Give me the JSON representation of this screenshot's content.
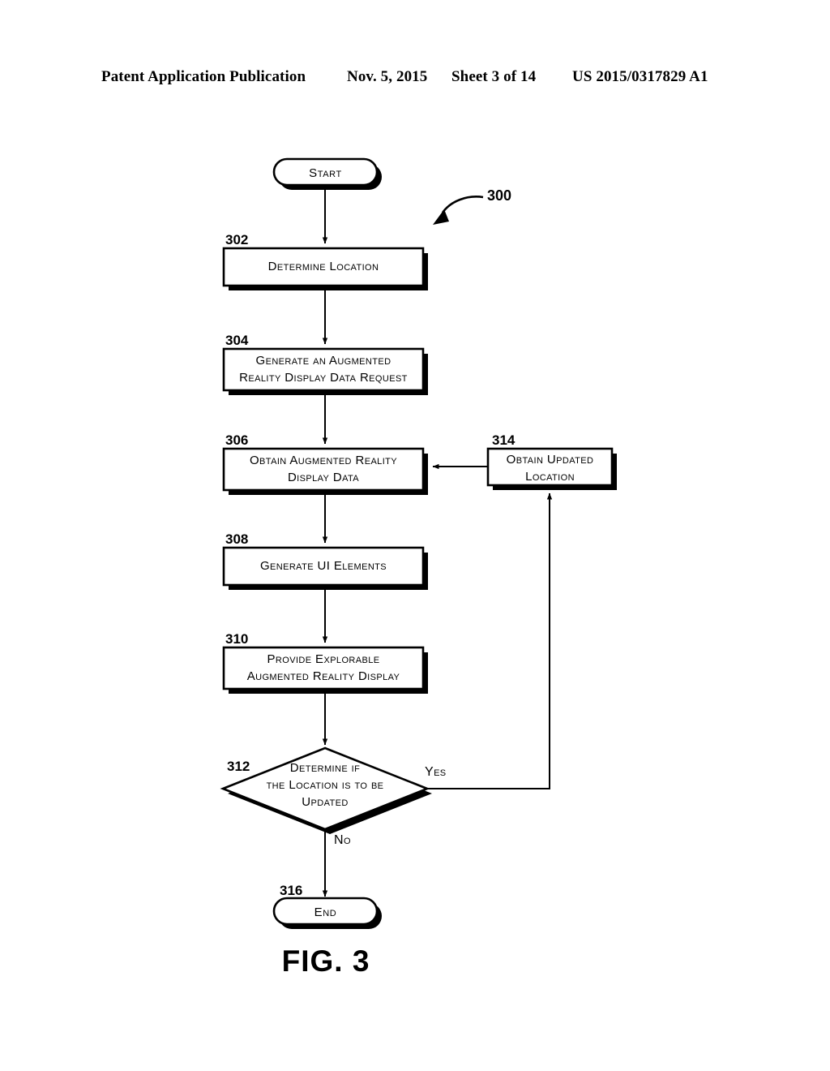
{
  "header": {
    "publication": "Patent Application Publication",
    "date": "Nov. 5, 2015",
    "sheet": "Sheet 3 of 14",
    "document_number": "US 2015/0317829 A1"
  },
  "figure": {
    "caption": "FIG. 3",
    "diagram_reference": "300"
  },
  "flowchart": {
    "start": {
      "ref": "",
      "label": "Start"
    },
    "end": {
      "ref": "316",
      "label": "End"
    },
    "nodes": [
      {
        "ref": "302",
        "label": "Determine Location",
        "lines": [
          "Determine Location"
        ],
        "shape": "process"
      },
      {
        "ref": "304",
        "label": "Generate an Augmented Reality Display Data Request",
        "lines": [
          "Generate an Augmented",
          "Reality Display Data Request"
        ],
        "shape": "process"
      },
      {
        "ref": "306",
        "label": "Obtain Augmented Reality Display Data",
        "lines": [
          "Obtain Augmented Reality",
          "Display Data"
        ],
        "shape": "process"
      },
      {
        "ref": "308",
        "label": "Generate UI Elements",
        "lines": [
          "Generate UI Elements"
        ],
        "shape": "process"
      },
      {
        "ref": "310",
        "label": "Provide Explorable Augmented Reality Display",
        "lines": [
          "Provide Explorable",
          "Augmented Reality Display"
        ],
        "shape": "process"
      },
      {
        "ref": "312",
        "label": "Determine if the Location is to be Updated",
        "lines": [
          "Determine if",
          "the Location is to be",
          "Updated"
        ],
        "shape": "decision"
      },
      {
        "ref": "314",
        "label": "Obtain Updated Location",
        "lines": [
          "Obtain Updated",
          "Location"
        ],
        "shape": "process"
      }
    ],
    "branches": {
      "yes": "Yes",
      "no": "No"
    }
  },
  "colors": {
    "ink": "#000000",
    "paper": "#ffffff"
  }
}
